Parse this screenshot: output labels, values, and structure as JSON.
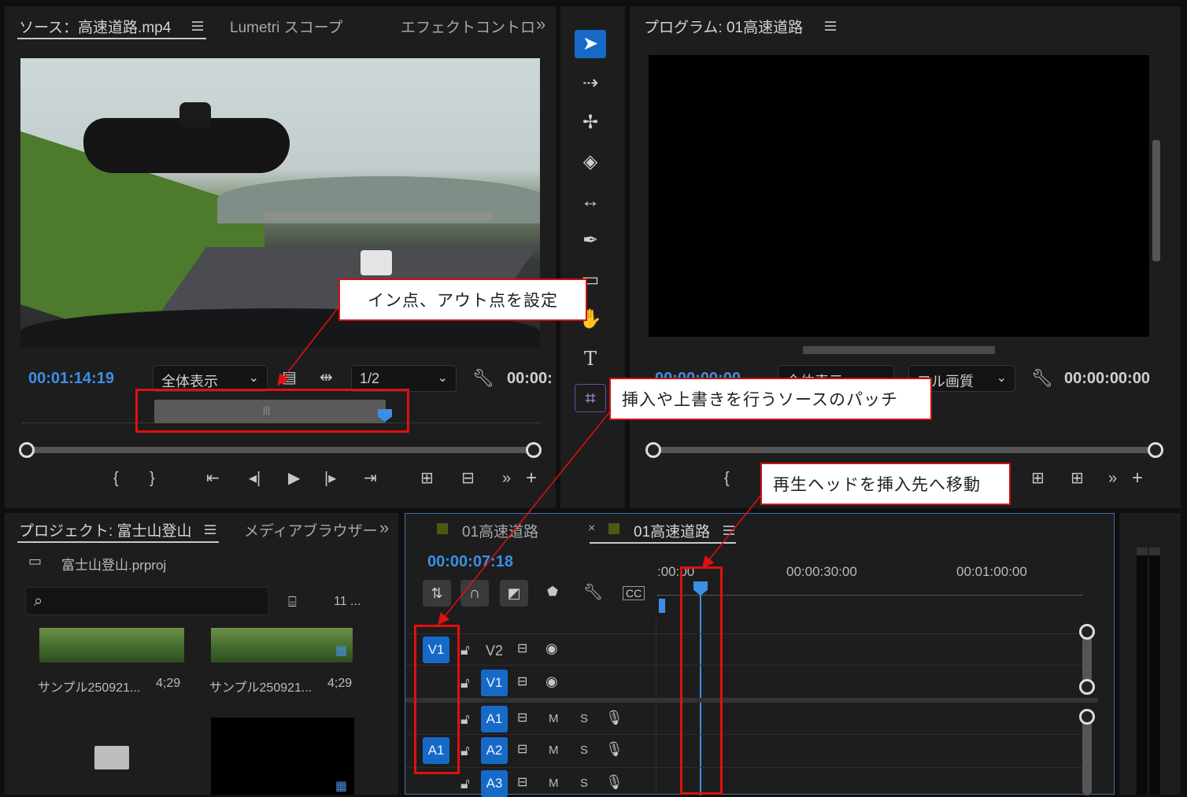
{
  "source": {
    "tabs": [
      "ソース：高速道路.mp4",
      "Lumetri スコープ",
      "エフェクトコントロ"
    ],
    "overflow": "»",
    "timecode": "00:01:14:19",
    "fit_dropdown": "全体表示",
    "resolution_dropdown": "1/2",
    "right_timecode": "00:00:"
  },
  "program": {
    "tab": "プログラム: 01高速道路",
    "timecode_left": "00:00:00:00",
    "fit_dropdown": "全体表示",
    "quality_dropdown": "フル画質",
    "timecode_right": "00:00:00:00"
  },
  "project": {
    "tab": "プロジェクト: 富士山登山",
    "tab2": "メディアブラウザー",
    "overflow": "»",
    "file": "富士山登山.prproj",
    "count": "11 ...",
    "items": [
      {
        "name": "サンプル250921...",
        "duration": "4;29"
      },
      {
        "name": "サンプル250921...",
        "duration": "4;29"
      }
    ]
  },
  "timeline": {
    "tab1": "01高速道路",
    "close": "×",
    "tab2": "01高速道路",
    "timecode": "00:00:07:18",
    "ruler": [
      ":00:00",
      "00:00:30:00",
      "00:01:00:00"
    ],
    "video_tracks": [
      {
        "src": "V1",
        "name": "V2"
      },
      {
        "src": "",
        "name": "V1"
      }
    ],
    "audio_tracks": [
      {
        "src": "",
        "name": "A1",
        "m": "M",
        "s": "S"
      },
      {
        "src": "A1",
        "name": "A2",
        "m": "M",
        "s": "S"
      },
      {
        "src": "",
        "name": "A3",
        "m": "M",
        "s": "S"
      }
    ]
  },
  "annotations": {
    "in_out": "イン点、アウト点を設定",
    "patch": "挿入や上書きを行うソースのパッチ",
    "playhead": "再生ヘッドを挿入先へ移動"
  },
  "colors": {
    "accent": "#3d8fe6",
    "track_button": "#1769c8",
    "annotation_border": "#e01010"
  }
}
